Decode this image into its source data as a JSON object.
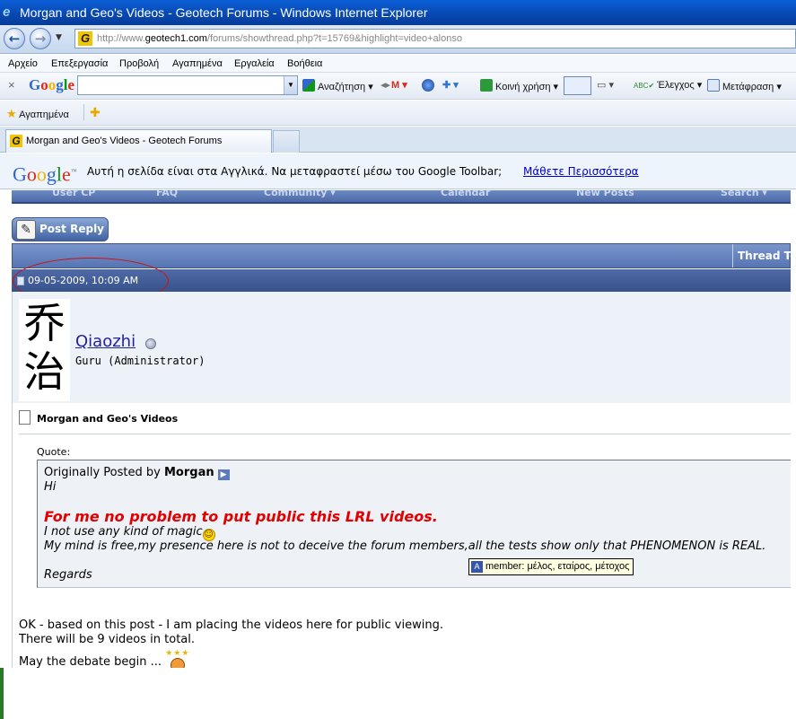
{
  "window": {
    "title": "Morgan and Geo's Videos - Geotech Forums - Windows Internet Explorer"
  },
  "address": {
    "url_prefix": "http://www.",
    "url_domain": "geotech1.com",
    "url_rest": "/forums/showthread.php?t=15769&highlight=video+alonso"
  },
  "menu": [
    "Αρχείο",
    "Επεξεργασία",
    "Προβολή",
    "Αγαπημένα",
    "Εργαλεία",
    "Βοήθεια"
  ],
  "google_toolbar": {
    "logo": "Google",
    "search_label": "Αναζήτηση",
    "share_label": "Κοινή χρήση",
    "check_label": "Έλεγχος",
    "translate_label": "Μετάφραση"
  },
  "favorites": {
    "label": "Αγαπημένα"
  },
  "tab": {
    "title": "Morgan and Geo's Videos - Geotech Forums"
  },
  "translate_bar": {
    "logo": "Google",
    "message": "Αυτή η σελίδα είναι στα Αγγλικά.  Να μεταφραστεί μέσω του Google Toolbar;",
    "link": "Μάθετε Περισσότερα"
  },
  "forum_nav": [
    "User CP",
    "FAQ",
    "Community ▾",
    "Calendar",
    "New Posts",
    "Search ▾"
  ],
  "post_reply": "Post Reply",
  "thread_tools": "Thread Tools",
  "post": {
    "date": "09-05-2009, 10:09 AM",
    "username": "Qiaozhi",
    "rank": "Guru (Administrator)",
    "avatar_chars": [
      "乔",
      "治"
    ],
    "title": "Morgan and Geo's Videos",
    "quote_label": "Quote:",
    "quote": {
      "originally_posted_by": "Originally Posted by",
      "author": "Morgan",
      "hi": "Hi",
      "big": "For me no problem to put public this LRL videos.",
      "magic": "I not use any kind of magic",
      "mind": "My mind is free,my presence here is not to deceive the forum members,all the tests show only that PHENOMENON is REAL.",
      "regards": "Regards"
    },
    "body": [
      "OK - based on this post - I am placing the videos here for public viewing.",
      "There will be 9 videos in total.",
      "May the debate begin ..."
    ]
  },
  "tooltip": "member: μέλος, εταίρος, μέτοχος",
  "colors": {
    "title_bar": "#0847b0",
    "forum_bar": "#4f6aa6",
    "quote_red": "#e30000",
    "link_blue": "#0000cc"
  }
}
